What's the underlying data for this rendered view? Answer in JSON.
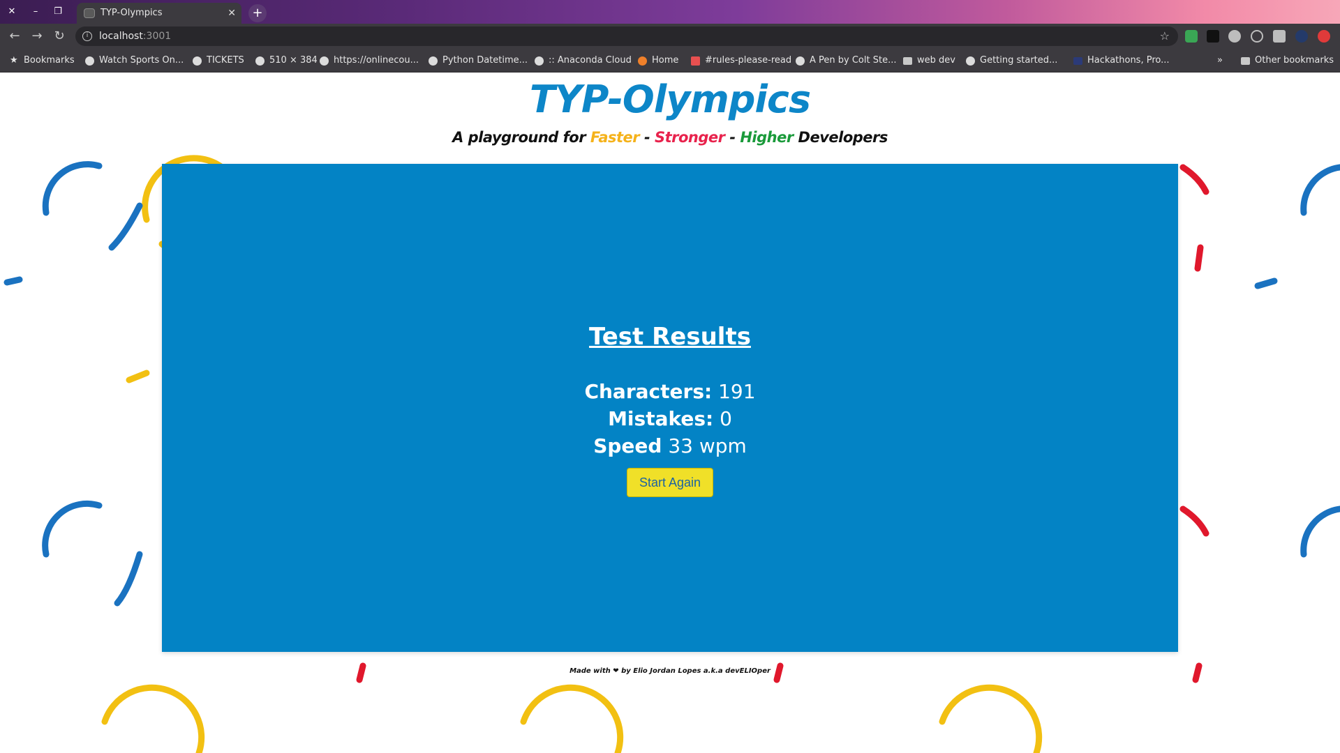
{
  "browser": {
    "tab_title": "TYP-Olympics",
    "new_tab": "+",
    "url_host": "localhost",
    "url_port": ":3001",
    "bookmarks": [
      {
        "label": "Bookmarks",
        "icon": "star-icon"
      },
      {
        "label": "Watch Sports On...",
        "icon": "globe-icon"
      },
      {
        "label": "TICKETS",
        "icon": "globe-icon"
      },
      {
        "label": "510 × 384",
        "icon": "globe-icon"
      },
      {
        "label": "https://onlinecou...",
        "icon": "globe-icon"
      },
      {
        "label": "Python Datetime...",
        "icon": "globe-icon"
      },
      {
        "label": ":: Anaconda Cloud",
        "icon": "globe-icon"
      },
      {
        "label": "Home",
        "icon": "jupyter-icon"
      },
      {
        "label": "#rules-please-read",
        "icon": "calendar-icon"
      },
      {
        "label": "A Pen by Colt Ste...",
        "icon": "globe-icon"
      },
      {
        "label": "web dev",
        "icon": "folder-icon"
      },
      {
        "label": "Getting started...",
        "icon": "globe-icon"
      },
      {
        "label": "Hackathons, Pro...",
        "icon": "site-icon"
      }
    ],
    "overflow": "»",
    "other_bookmarks": "Other bookmarks"
  },
  "header": {
    "title": "TYP-Olympics",
    "tagline_prefix": "A playground for ",
    "faster": "Faster",
    "sep1": " - ",
    "stronger": "Stronger",
    "sep2": " - ",
    "higher": "Higher",
    "tagline_suffix": " Developers"
  },
  "results": {
    "title": "Test Results",
    "characters_label": "Characters:",
    "characters_value": "191",
    "mistakes_label": "Mistakes:",
    "mistakes_value": "0",
    "speed_label": "Speed",
    "speed_value": "33 wpm",
    "start_again": "Start Again"
  },
  "footer": {
    "text": "Made with ❤ by Elio Jordan Lopes a.k.a devELIOper"
  },
  "colors": {
    "card": "#0383c5",
    "title": "#0d86c8",
    "button": "#f0e028",
    "ring_blue": "#1a72c0",
    "ring_yellow": "#f2c012",
    "ring_black": "#111111",
    "ring_red": "#e0182c"
  }
}
